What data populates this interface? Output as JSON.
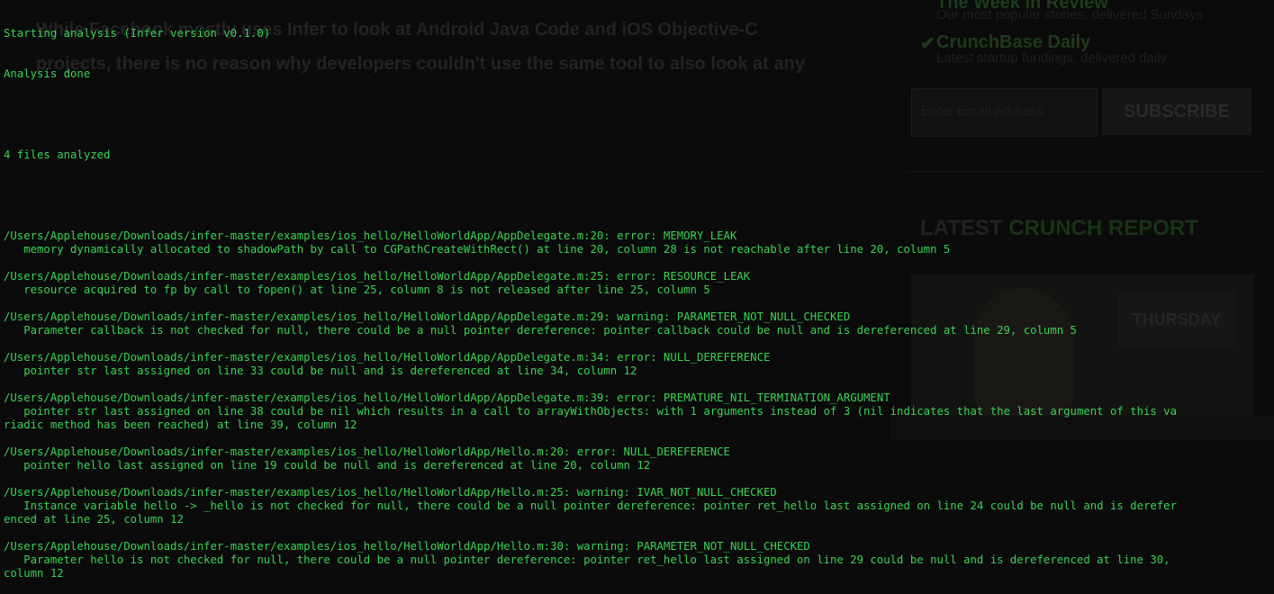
{
  "background_page": {
    "article_lines": [
      "While Facebook mostly uses Infer to look at Android Java Code and iOS Objective-C",
      "projects, there is no reason why developers couldn't use the same tool to also look at any"
    ],
    "sidebar_items": [
      {
        "title": "The Week in Review",
        "desc": "Our most popular stories, delivered Sundays"
      },
      {
        "title": "CrunchBase Daily",
        "desc": "Latest startup fundings, delivered daily"
      }
    ],
    "email_placeholder": "Enter Email Address",
    "subscribe_label": "SUBSCRIBE",
    "latest_label": "LATEST",
    "crunch_report_label": "CRUNCH REPORT",
    "video_badge": "THURSDAY"
  },
  "terminal": {
    "header_lines": [
      "Starting analysis (Infer version v0.1.0)",
      "Analysis done"
    ],
    "files_analyzed": "4 files analyzed",
    "issues": [
      {
        "location": "/Users/Applehouse/Downloads/infer-master/examples/ios_hello/HelloWorldApp/AppDelegate.m:20: error: MEMORY_LEAK",
        "detail": [
          "   memory dynamically allocated to shadowPath by call to CGPathCreateWithRect() at line 20, column 28 is not reachable after line 20, column 5"
        ]
      },
      {
        "location": "/Users/Applehouse/Downloads/infer-master/examples/ios_hello/HelloWorldApp/AppDelegate.m:25: error: RESOURCE_LEAK",
        "detail": [
          "   resource acquired to fp by call to fopen() at line 25, column 8 is not released after line 25, column 5"
        ]
      },
      {
        "location": "/Users/Applehouse/Downloads/infer-master/examples/ios_hello/HelloWorldApp/AppDelegate.m:29: warning: PARAMETER_NOT_NULL_CHECKED",
        "detail": [
          "   Parameter callback is not checked for null, there could be a null pointer dereference: pointer callback could be null and is dereferenced at line 29, column 5"
        ]
      },
      {
        "location": "/Users/Applehouse/Downloads/infer-master/examples/ios_hello/HelloWorldApp/AppDelegate.m:34: error: NULL_DEREFERENCE",
        "detail": [
          "   pointer str last assigned on line 33 could be null and is dereferenced at line 34, column 12"
        ]
      },
      {
        "location": "/Users/Applehouse/Downloads/infer-master/examples/ios_hello/HelloWorldApp/AppDelegate.m:39: error: PREMATURE_NIL_TERMINATION_ARGUMENT",
        "detail": [
          "   pointer str last assigned on line 38 could be nil which results in a call to arrayWithObjects: with 1 arguments instead of 3 (nil indicates that the last argument of this va",
          "riadic method has been reached) at line 39, column 12"
        ]
      },
      {
        "location": "/Users/Applehouse/Downloads/infer-master/examples/ios_hello/HelloWorldApp/Hello.m:20: error: NULL_DEREFERENCE",
        "detail": [
          "   pointer hello last assigned on line 19 could be null and is dereferenced at line 20, column 12"
        ]
      },
      {
        "location": "/Users/Applehouse/Downloads/infer-master/examples/ios_hello/HelloWorldApp/Hello.m:25: warning: IVAR_NOT_NULL_CHECKED",
        "detail": [
          "   Instance variable hello -> _hello is not checked for null, there could be a null pointer dereference: pointer ret_hello last assigned on line 24 could be null and is derefer",
          "enced at line 25, column 12"
        ]
      },
      {
        "location": "/Users/Applehouse/Downloads/infer-master/examples/ios_hello/HelloWorldApp/Hello.m:30: warning: PARAMETER_NOT_NULL_CHECKED",
        "detail": [
          "   Parameter hello is not checked for null, there could be a null pointer dereference: pointer ret_hello last assigned on line 29 could be null and is dereferenced at line 30,",
          "column 12"
        ]
      }
    ],
    "text_color": "#39d353",
    "background_color": "#0b0b0b"
  }
}
